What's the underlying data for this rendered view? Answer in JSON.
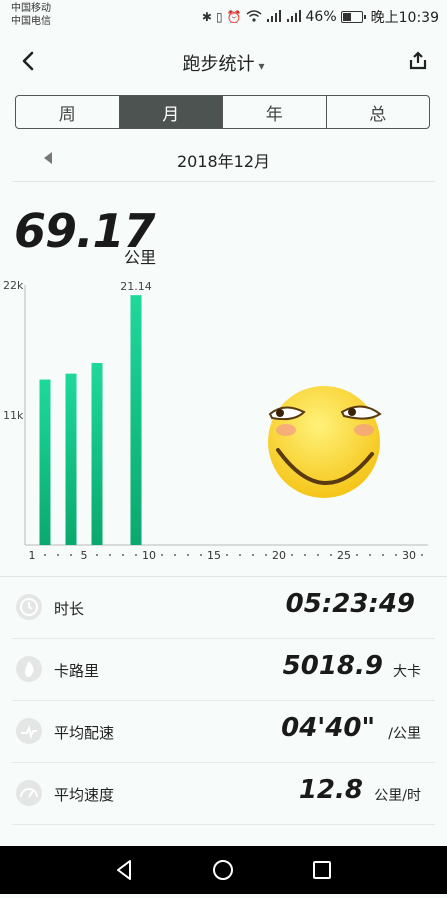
{
  "status_bar": {
    "carrier1": "中国移动",
    "carrier2": "中国电信",
    "battery": "46%",
    "time": "晚上10:39",
    "signal1": "2G",
    "signal2": "4G"
  },
  "header": {
    "title": "跑步统计"
  },
  "tabs": [
    {
      "label": "周"
    },
    {
      "label": "月"
    },
    {
      "label": "年"
    },
    {
      "label": "总"
    }
  ],
  "active_tab": "月",
  "period": "2018年12月",
  "summary": {
    "total": "69.17",
    "unit": "公里"
  },
  "chart_data": {
    "type": "bar",
    "x": [
      1,
      2,
      3,
      4,
      5,
      6,
      7,
      8,
      9,
      10,
      11,
      12,
      13,
      14,
      15,
      16,
      17,
      18,
      19,
      20,
      21,
      22,
      23,
      24,
      25,
      26,
      27,
      28,
      29,
      30,
      31
    ],
    "values": [
      0,
      14.0,
      0,
      14.5,
      0,
      15.4,
      0,
      0,
      21.14,
      0,
      0,
      0,
      0,
      0,
      0,
      0,
      0,
      0,
      0,
      0,
      0,
      0,
      0,
      0,
      0,
      0,
      0,
      0,
      0,
      0,
      0
    ],
    "ylim": [
      0,
      22
    ],
    "ytick_labels": [
      "22k",
      "11k"
    ],
    "ytick_values": [
      22,
      11
    ],
    "xtick_labels": [
      "1",
      "5",
      "10",
      "15",
      "20",
      "25",
      "30"
    ],
    "xtick_values": [
      1,
      5,
      10,
      15,
      20,
      25,
      30
    ],
    "data_labels": [
      {
        "x": 9,
        "label": "21.14"
      }
    ],
    "bar_color_top": "#1ed99b",
    "bar_color_bottom": "#0aa86e"
  },
  "stats": [
    {
      "label": "时长",
      "value": "05:23:49",
      "unit": "",
      "icon": "clock-icon"
    },
    {
      "label": "卡路里",
      "value": "5018.9",
      "unit": "大卡",
      "icon": "flame-icon"
    },
    {
      "label": "平均配速",
      "value": "04'40\"",
      "unit": "/公里",
      "icon": "pace-icon"
    },
    {
      "label": "平均速度",
      "value": "12.8",
      "unit": "公里/时",
      "icon": "speed-icon"
    }
  ]
}
